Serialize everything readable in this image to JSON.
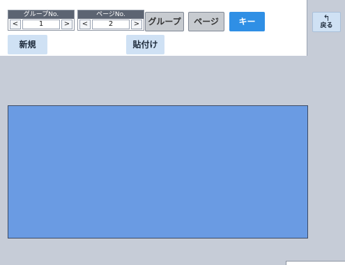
{
  "toolbar": {
    "group_stepper": {
      "label": "グループNo.",
      "value": "1",
      "prev": "<",
      "next": ">"
    },
    "page_stepper": {
      "label": "ページNo.",
      "value": "2",
      "prev": "<",
      "next": ">"
    },
    "modes": {
      "group": "グループ",
      "page": "ページ",
      "key": "キー"
    },
    "new_label": "新規",
    "paste_label": "貼付け"
  },
  "back": {
    "glyph": "↰",
    "label": "戻る"
  },
  "colors": {
    "accent": "#2f8fe5",
    "key_area": "#6a9be3",
    "action": "#cfe1f4"
  }
}
